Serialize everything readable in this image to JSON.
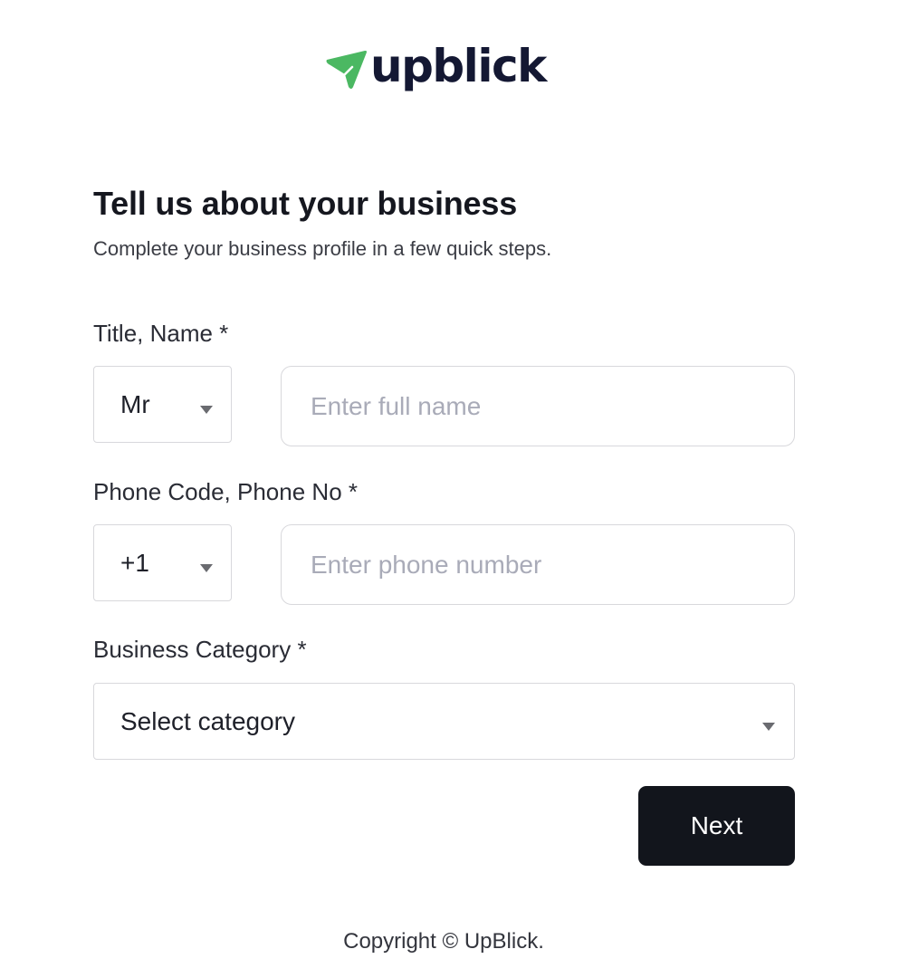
{
  "brand": {
    "name": "upblick",
    "logo_icon": "paper-plane-arrow-icon",
    "logo_icon_color": "#4bb862",
    "wordmark_color": "#141833"
  },
  "page": {
    "title": "Tell us about your business",
    "subtitle": "Complete your business profile in a few quick steps."
  },
  "form": {
    "title_name": {
      "label": "Title, Name *",
      "title_value": "Mr",
      "name_placeholder": "Enter full name",
      "name_value": ""
    },
    "phone": {
      "label": "Phone Code, Phone No *",
      "code_value": "+1",
      "number_placeholder": "Enter phone number",
      "number_value": ""
    },
    "category": {
      "label": "Business Category *",
      "selected": "Select category"
    },
    "next_label": "Next"
  },
  "footer": {
    "copyright": "Copyright © UpBlick."
  },
  "colors": {
    "primary_button": "#12151c",
    "border": "#d8d8dc",
    "placeholder": "#a9abb8"
  }
}
